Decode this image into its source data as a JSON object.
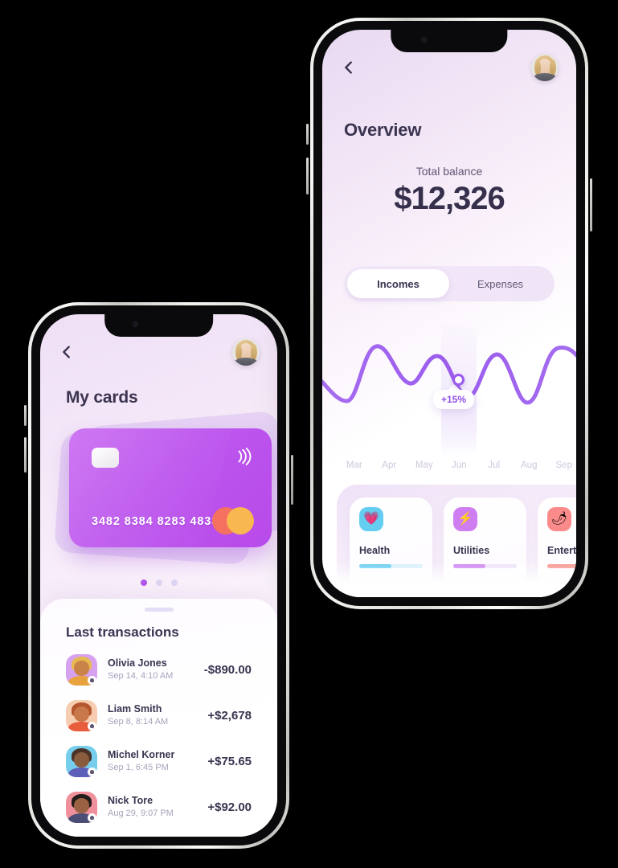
{
  "phones": {
    "left": {
      "screen_name": "my-cards",
      "back_icon": "chevron-left-icon",
      "avatar_alt": "user-avatar",
      "title": "My cards",
      "card": {
        "number": "3482 8384 8283 4833",
        "chip_icon": "chip-icon",
        "contactless_icon": "contactless-icon",
        "network_icon": "mastercard-icon",
        "gradient_from": "#c766f0",
        "gradient_to": "#b84ae9"
      },
      "pagination": {
        "total": 3,
        "active": 1,
        "active_color": "#b356ec",
        "inactive_color": "#ddd6f2"
      },
      "sheet": {
        "heading": "Last transactions",
        "transactions": [
          {
            "name": "Olivia Jones",
            "date": "Sep 14, 4:10 AM",
            "amount": "-$890.00",
            "avatar_bg": "#d6a2f0",
            "skin": "#c98248",
            "hair": "#e8b950",
            "shirt": "#e8a33f"
          },
          {
            "name": "Liam Smith",
            "date": "Sep 8, 8:14 AM",
            "amount": "+$2,678",
            "avatar_bg": "#f7cdb2",
            "skin": "#c9784a",
            "hair": "#b4552e",
            "shirt": "#e85d3c"
          },
          {
            "name": "Michel Korner",
            "date": "Sep 1, 6:45 PM",
            "amount": "+$75.65",
            "avatar_bg": "#77cdec",
            "skin": "#8a5c3e",
            "hair": "#4a3226",
            "shirt": "#5d5fb8"
          },
          {
            "name": "Nick Tore",
            "date": "Aug 29, 9:07 PM",
            "amount": "+$92.00",
            "avatar_bg": "#f0909c",
            "skin": "#9a6142",
            "hair": "#241c1a",
            "shirt": "#4a4e74"
          }
        ]
      }
    },
    "right": {
      "screen_name": "overview",
      "back_icon": "chevron-left-icon",
      "avatar_alt": "user-avatar",
      "title": "Overview",
      "balance": {
        "label": "Total balance",
        "value": "$12,326"
      },
      "tabs": [
        {
          "label": "Incomes",
          "active": true
        },
        {
          "label": "Expenses",
          "active": false
        }
      ],
      "chart_tooltip": "+15%",
      "categories": [
        {
          "label": "Health",
          "icon": "heart-icon",
          "icon_emoji": "💗",
          "icon_bg": "#64cdf0",
          "bar_track": "#d7f0fb",
          "bar_fill": "#5fcbf0",
          "progress": 50
        },
        {
          "label": "Utilities",
          "icon": "bolt-icon",
          "icon_emoji": "⚡",
          "icon_bg": "#cf7ef2",
          "bar_track": "#efe2fb",
          "bar_fill": "#cd7ff0",
          "progress": 50
        },
        {
          "label": "Entertainment",
          "icon": "chili-icon",
          "icon_emoji": "🌶",
          "icon_bg": "#fb8b8b",
          "bar_track": "#fbdedc",
          "bar_fill": "#f79189",
          "progress": 50
        }
      ]
    }
  },
  "chart_data": {
    "type": "line",
    "title": "",
    "xlabel": "",
    "ylabel": "",
    "categories": [
      "Mar",
      "Apr",
      "May",
      "Jun",
      "Jul",
      "Aug",
      "Sep"
    ],
    "values": [
      58,
      30,
      78,
      52,
      70,
      28,
      80
    ],
    "ylim": [
      0,
      100
    ],
    "grid": false,
    "legend": "none",
    "line_color": "#9b5bed",
    "line_width": 5,
    "highlight": {
      "category": "Jun",
      "label": "+15%",
      "value": 52
    },
    "tick_label_color": "#cfc6dd"
  }
}
